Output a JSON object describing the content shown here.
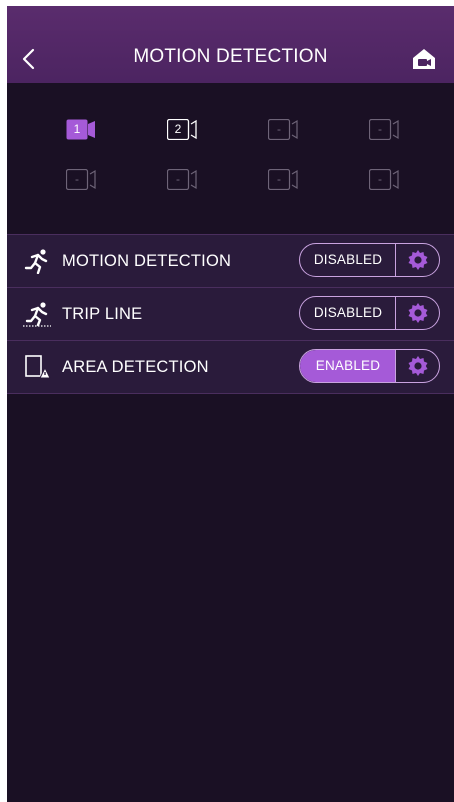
{
  "header": {
    "title": "MOTION DETECTION",
    "back_icon": "chevron-left-icon",
    "home_icon": "home-camera-icon"
  },
  "cameras": [
    {
      "label": "1",
      "state": "selected"
    },
    {
      "label": "2",
      "state": "available"
    },
    {
      "label": "-",
      "state": "empty"
    },
    {
      "label": "-",
      "state": "empty"
    },
    {
      "label": "-",
      "state": "empty"
    },
    {
      "label": "-",
      "state": "empty"
    },
    {
      "label": "-",
      "state": "empty"
    },
    {
      "label": "-",
      "state": "empty"
    }
  ],
  "settings": [
    {
      "label": "MOTION DETECTION",
      "icon": "running-person-icon",
      "status": "DISABLED",
      "enabled": false
    },
    {
      "label": "TRIP LINE",
      "icon": "trip-line-icon",
      "status": "DISABLED",
      "enabled": false
    },
    {
      "label": "AREA DETECTION",
      "icon": "area-detection-icon",
      "status": "ENABLED",
      "enabled": true
    }
  ],
  "colors": {
    "accent": "#a55ad8",
    "header": "#4f2664",
    "background": "#1a1024",
    "row": "#2a1b3b",
    "inactive": "#6e6478"
  }
}
